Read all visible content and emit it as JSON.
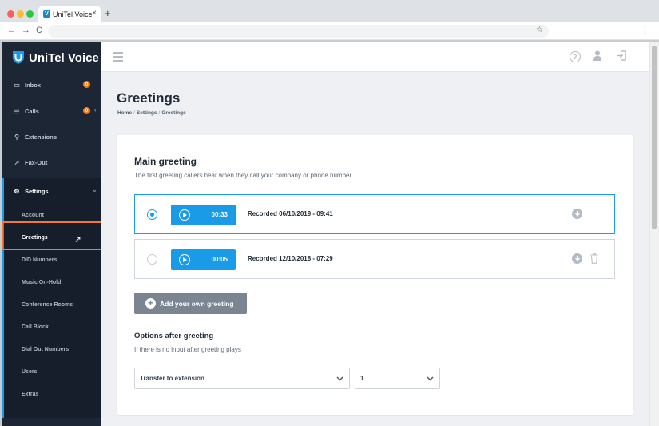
{
  "browser": {
    "tab_title": "UniTel Voice",
    "tab_close": "×",
    "new_tab": "+",
    "back": "←",
    "forward": "→",
    "reload": "C",
    "bookmark_star": "☆",
    "menu": "⋮"
  },
  "sidebar": {
    "brand": "UniTel Voice",
    "items": [
      {
        "label": "Inbox",
        "icon": "inbox-icon",
        "badge": "0"
      },
      {
        "label": "Calls",
        "icon": "list-icon",
        "badge": "0"
      },
      {
        "label": "Extensions",
        "icon": "hierarchy-icon"
      },
      {
        "label": "Fax-Out",
        "icon": "external-link-icon"
      }
    ],
    "settings": {
      "label": "Settings",
      "icon": "gear-icon",
      "sub_items": [
        "Account",
        "Greetings",
        "DID Numbers",
        "Music On-Hold",
        "Conference Rooms",
        "Call Block",
        "Dial Out Numbers",
        "Users",
        "Extras"
      ],
      "active": "Greetings"
    },
    "highlight_color": "#f37735"
  },
  "page": {
    "title": "Greetings",
    "breadcrumb": [
      "Home",
      "Settings",
      "Greetings"
    ],
    "breadcrumb_sep": "/"
  },
  "main_greeting": {
    "title": "Main greeting",
    "description": "The first greeting callers hear when they call your company or phone number.",
    "greetings": [
      {
        "duration": "00:33",
        "label": "Recorded 06/10/2019 - 09:41",
        "selected": true,
        "deletable": false
      },
      {
        "duration": "00:05",
        "label": "Recorded 12/10/2018 - 07:29",
        "selected": false,
        "deletable": true
      }
    ],
    "add_button": "Add your own greeting"
  },
  "options": {
    "title": "Options after greeting",
    "description": "If there is no input after greeting plays",
    "action_select": "Transfer to extension",
    "target_select": "1"
  },
  "colors": {
    "accent": "#1a9be8",
    "sidebar": "#1c2634",
    "badge": "#f47b20",
    "button_grey": "#7b8592"
  }
}
